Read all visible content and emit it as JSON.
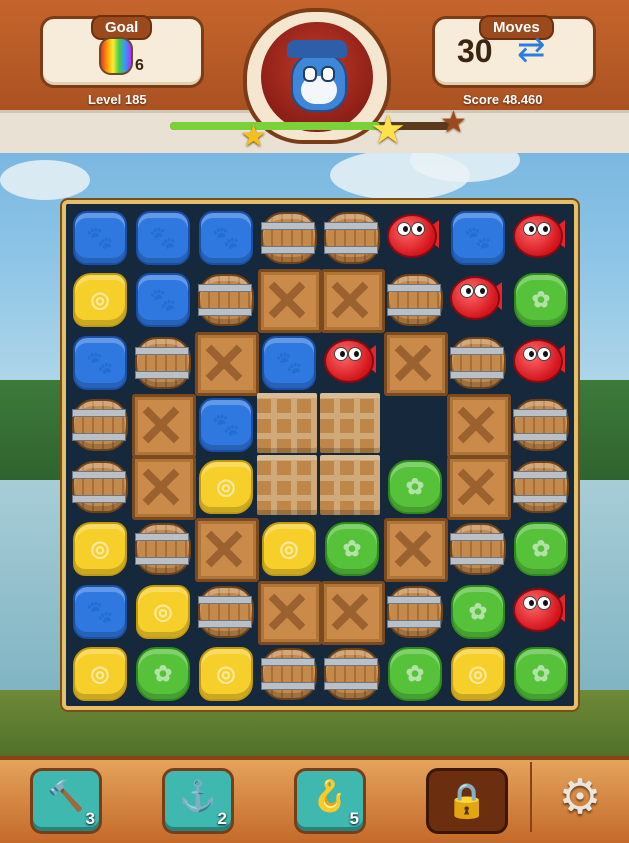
{
  "hud": {
    "goal_label": "Goal",
    "goal_count": "6",
    "goal_icon": "rainbow-jar-icon",
    "level_text": "Level 185",
    "moves_label": "Moves",
    "moves_value": "30",
    "moves_icon": "swap-arrows-icon",
    "score_text": "Score 48.460",
    "score_progress": 0.75,
    "stars_earned": 2,
    "stars_total": 3
  },
  "board": {
    "columns": 8,
    "rows": 8,
    "grid": [
      [
        "blue",
        "blue",
        "blue",
        "barrel",
        "barrel",
        "fish",
        "blue",
        "fish"
      ],
      [
        "yellow",
        "blue",
        "barrel",
        "crate",
        "crate",
        "barrel",
        "fish",
        "green"
      ],
      [
        "blue",
        "barrel",
        "crate",
        "blue",
        "fish",
        "crate",
        "barrel",
        "fish"
      ],
      [
        "barrel",
        "crate",
        "blue",
        "rope",
        "rope",
        "empty",
        "crate",
        "barrel"
      ],
      [
        "barrel",
        "crate",
        "yellow",
        "rope",
        "rope",
        "green",
        "crate",
        "barrel"
      ],
      [
        "yellow",
        "barrel",
        "crate",
        "yellow",
        "green",
        "crate",
        "barrel",
        "green"
      ],
      [
        "blue",
        "yellow",
        "barrel",
        "crate",
        "crate",
        "barrel",
        "green",
        "fish"
      ],
      [
        "yellow",
        "green",
        "yellow",
        "barrel",
        "barrel",
        "green",
        "yellow",
        "green"
      ]
    ]
  },
  "boosters": [
    {
      "name": "hammer",
      "icon": "hammer-icon",
      "count": "3"
    },
    {
      "name": "anchor",
      "icon": "anchor-icon",
      "count": "2"
    },
    {
      "name": "hook",
      "icon": "hook-icon",
      "count": "5"
    }
  ],
  "locked_booster_icon": "padlock-icon",
  "settings_icon": "gear-icon",
  "colors": {
    "blue_tile": "#2f78e0",
    "yellow_tile": "#f7cf2a",
    "green_tile": "#56c23a",
    "fish": "#d3141c",
    "hud_brown": "#a44d1f"
  }
}
